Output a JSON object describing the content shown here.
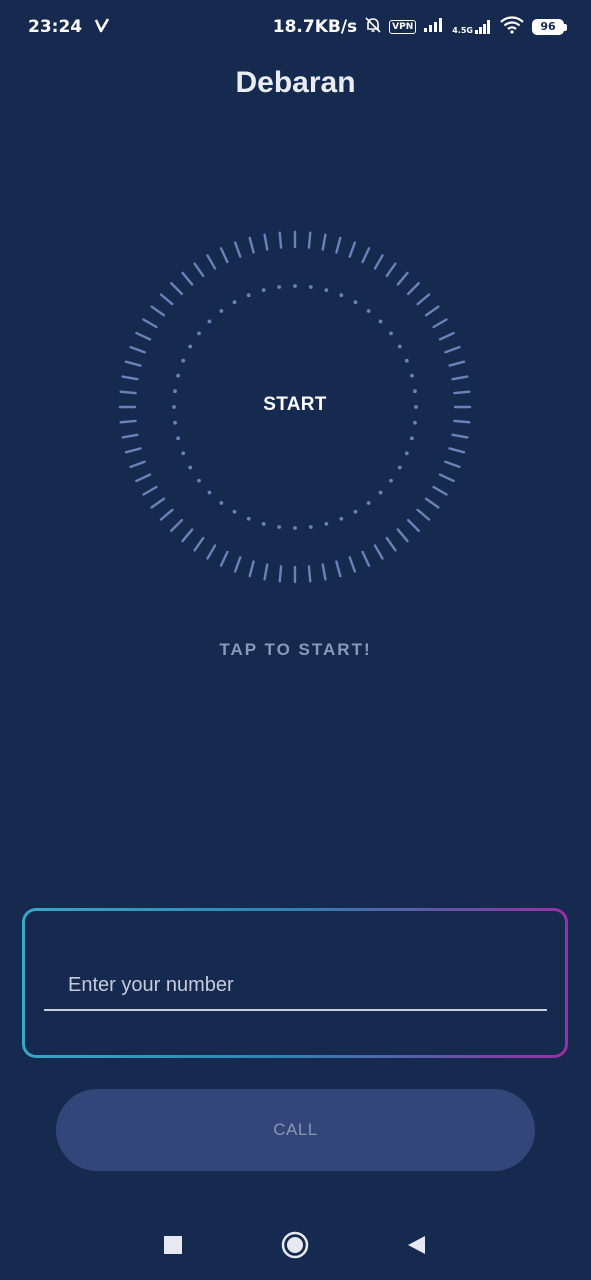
{
  "status_bar": {
    "time": "23:24",
    "network_speed": "18.7KB/s",
    "vpn_label": "VPN",
    "network_type": "4.5G",
    "battery_level": "96",
    "icons": [
      "v-check-icon",
      "mute-bell-icon",
      "vpn-icon",
      "signal-icon",
      "signal-4-5g-icon",
      "wifi-icon",
      "battery-icon"
    ]
  },
  "app": {
    "title": "Debaran"
  },
  "dial": {
    "start_label": "START",
    "hint": "TAP TO START!",
    "outer_tick_count": 72,
    "inner_dot_count": 48,
    "tick_color": "#6b82b6",
    "dot_color": "#6b82b6"
  },
  "form": {
    "number_placeholder": "Enter your number",
    "number_value": "",
    "call_label": "CALL"
  },
  "nav": {
    "icons": [
      "recents-square-icon",
      "home-circle-icon",
      "back-triangle-icon"
    ]
  },
  "colors": {
    "background": "#16294f",
    "button_bg": "#33467a",
    "gradient_start": "#3aa6c6",
    "gradient_end": "#9b2ea5"
  }
}
